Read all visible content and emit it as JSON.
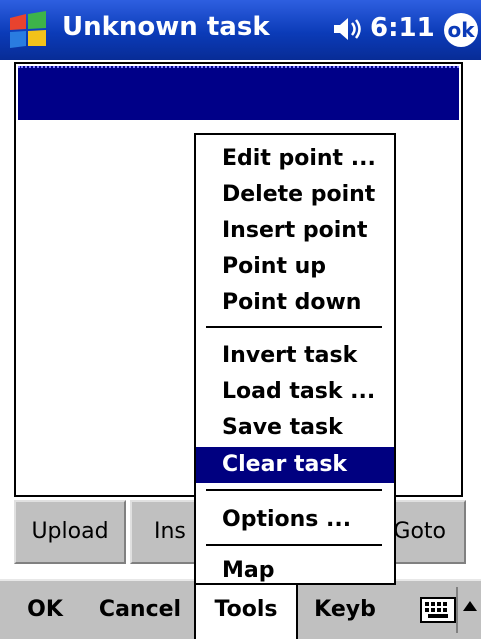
{
  "titlebar": {
    "title": "Unknown task",
    "clock": "6:11",
    "ok_label": "ok"
  },
  "buttons": [
    "Upload",
    "Ins",
    "Goto"
  ],
  "menubar": {
    "ok": "OK",
    "cancel": "Cancel",
    "tools": "Tools",
    "keyb": "Keyb"
  },
  "popup": {
    "items": [
      "Edit point ...",
      "Delete point",
      "Insert point",
      "Point up",
      "Point down",
      "Invert task",
      "Load task ...",
      "Save task",
      "Clear task",
      "Options ...",
      "Map"
    ],
    "highlighted": "Clear task"
  },
  "colors": {
    "titlebar": "#0b3bb8",
    "selection": "#000080",
    "chrome": "#c0c0c0"
  }
}
